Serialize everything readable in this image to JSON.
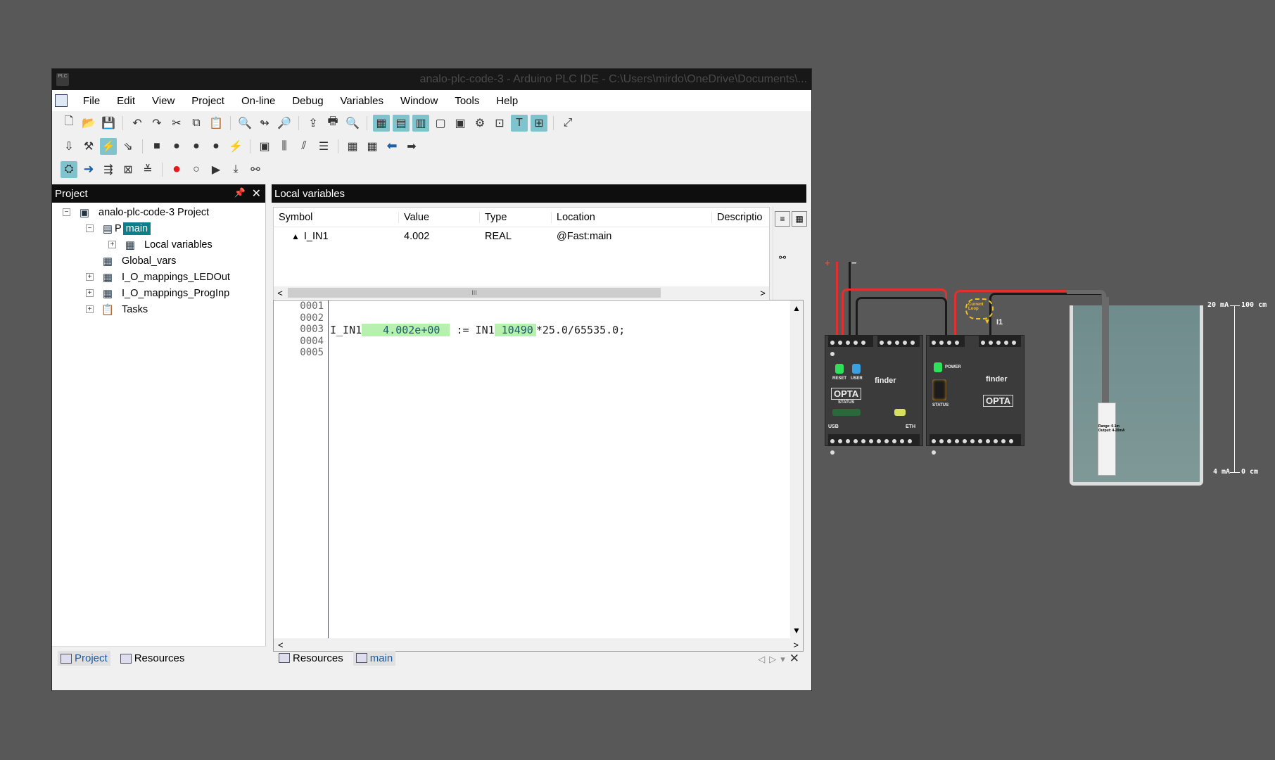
{
  "window": {
    "app_icon": "plc-logo-icon",
    "app_icon_text": "PLC",
    "title": "analo-plc-code-3 - Arduino PLC IDE - C:\\Users\\mirdo\\OneDrive\\Documents\\..."
  },
  "menu": [
    "File",
    "Edit",
    "View",
    "Project",
    "On-line",
    "Debug",
    "Variables",
    "Window",
    "Tools",
    "Help"
  ],
  "project_panel": {
    "title": "Project",
    "tree": {
      "root": "analo-plc-code-3 Project",
      "main": "main",
      "main_prefix": "P",
      "local_variables": "Local variables",
      "global_vars": "Global_vars",
      "led_out": "I_O_mappings_LEDOut",
      "prog_inp": "I_O_mappings_ProgInp",
      "tasks": "Tasks"
    },
    "bottom_tabs": [
      "Project",
      "Resources"
    ]
  },
  "local_vars": {
    "title": "Local variables",
    "columns": [
      "Symbol",
      "Value",
      "Type",
      "Location",
      "Descriptio"
    ],
    "rows": [
      {
        "symbol": "I_IN1",
        "value": "4.002",
        "type": "REAL",
        "location": "@Fast:main",
        "description": ""
      }
    ],
    "scroll_thumb": "III"
  },
  "editor": {
    "line_numbers": [
      "0001",
      "0002",
      "0003",
      "0004",
      "0005"
    ],
    "code": {
      "var": "I_IN1",
      "var_value": "4.002e+00",
      "assign": " := IN1",
      "in_value": "10490",
      "rest": "*25.0/65535.0;"
    }
  },
  "editor_tabs": [
    "Resources",
    "main"
  ],
  "hardware": {
    "plus": "+",
    "minus": "−",
    "current_loop_label": "Current\nLoop",
    "channel": "I1",
    "plc_brand": "finder",
    "plc_model": "OPTA",
    "plc_left_labels": {
      "reset": "RESET",
      "user": "USER",
      "status": "STATUS",
      "usb": "USB",
      "eth": "ETH"
    },
    "plc_right_labels": {
      "power": "POWER",
      "status": "STATUS"
    },
    "sensor_label": "Range: 0-1m\nOutput: 4-20mA",
    "scale_top": "20 mA",
    "scale_top_level": "100 cm",
    "scale_bottom": "4 mA",
    "scale_bottom_level": "0 cm",
    "colors": {
      "wire_red": "#e03030",
      "wire_black": "#1a1a1a",
      "highlight": "#b8f0b0",
      "selection": "#0b7f8a"
    }
  }
}
